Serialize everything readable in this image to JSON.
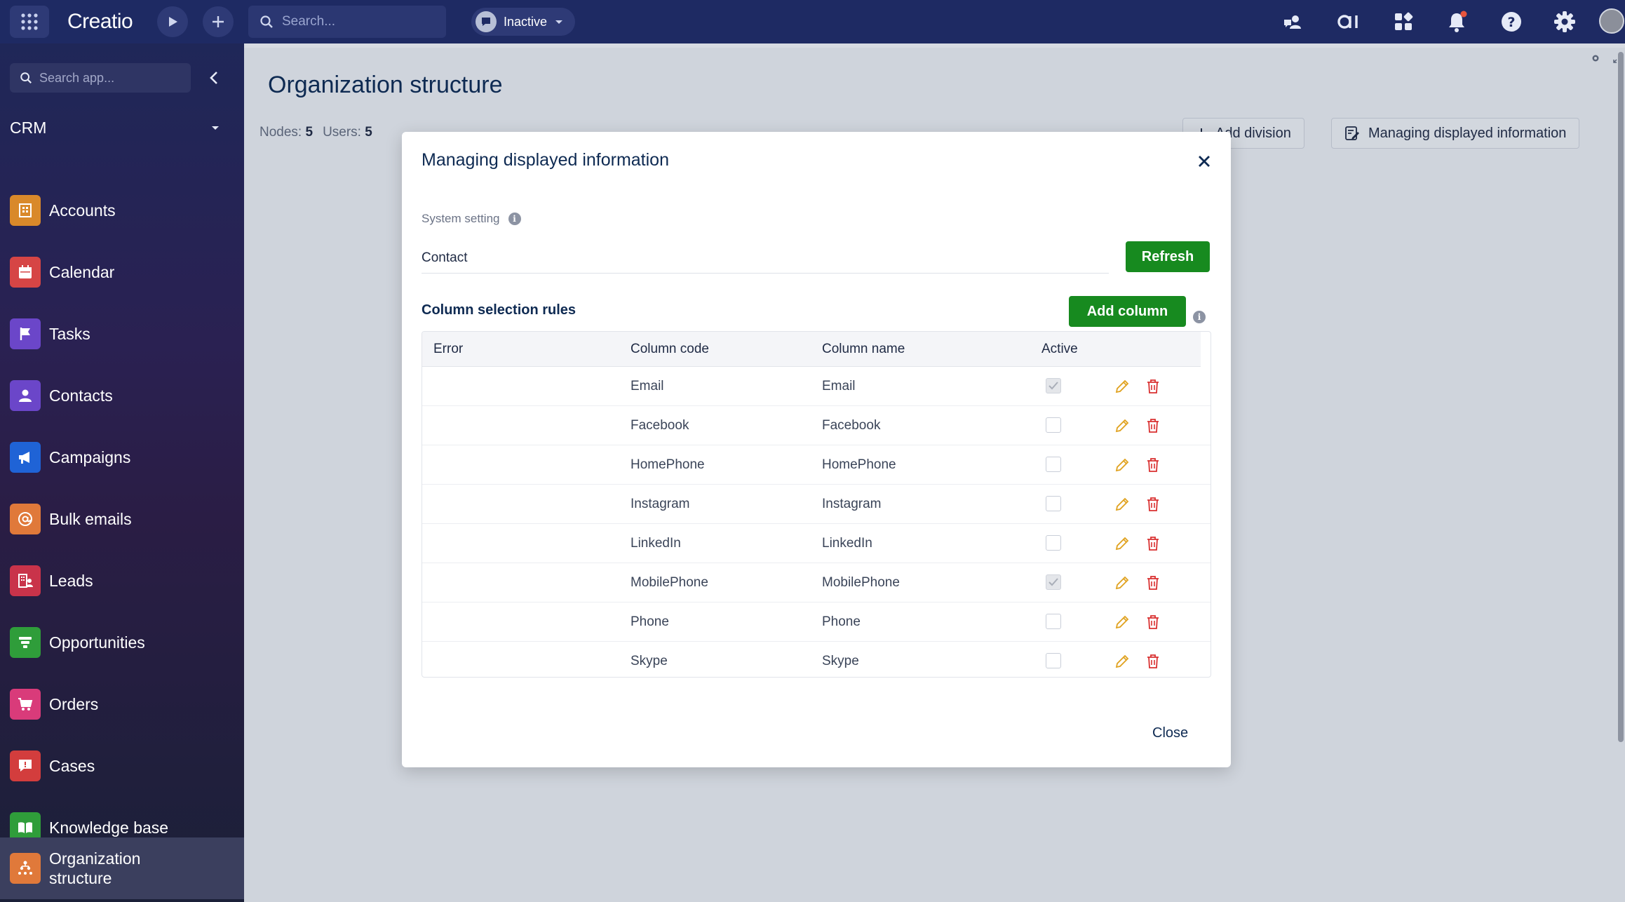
{
  "topbar": {
    "logo": "Creatio",
    "search_placeholder": "Search...",
    "status": "Inactive"
  },
  "sidebar": {
    "search_placeholder": "Search app...",
    "workspace": "CRM",
    "items": [
      {
        "label": "Accounts",
        "icon": "building-icon",
        "color": "#d9892a"
      },
      {
        "label": "Calendar",
        "icon": "calendar-icon",
        "color": "#d64545"
      },
      {
        "label": "Tasks",
        "icon": "flag-icon",
        "color": "#6b46c9"
      },
      {
        "label": "Contacts",
        "icon": "person-icon",
        "color": "#6b46c9"
      },
      {
        "label": "Campaigns",
        "icon": "megaphone-icon",
        "color": "#1f63d6"
      },
      {
        "label": "Bulk emails",
        "icon": "at-icon",
        "color": "#e0793a"
      },
      {
        "label": "Leads",
        "icon": "leads-icon",
        "color": "#c9334a"
      },
      {
        "label": "Opportunities",
        "icon": "funnel-icon",
        "color": "#2f9d3a"
      },
      {
        "label": "Orders",
        "icon": "cart-icon",
        "color": "#d93b7a"
      },
      {
        "label": "Cases",
        "icon": "chat-alert-icon",
        "color": "#d33d3d"
      },
      {
        "label": "Knowledge base",
        "icon": "book-icon",
        "color": "#2f9d3a"
      },
      {
        "label": "Organization structure",
        "icon": "org-chart-icon",
        "color": "#e0793a"
      }
    ]
  },
  "page": {
    "title": "Organization structure",
    "nodes_label": "Nodes:",
    "nodes_value": "5",
    "users_label": "Users:",
    "users_value": "5",
    "add_division": "Add division",
    "managing_info": "Managing displayed information"
  },
  "modal": {
    "title": "Managing displayed information",
    "system_setting_label": "System setting",
    "system_setting_value": "Contact",
    "refresh": "Refresh",
    "rules_heading": "Column selection rules",
    "add_column": "Add column",
    "columns": [
      "Error",
      "Column code",
      "Column name",
      "Active"
    ],
    "rows": [
      {
        "error": "",
        "code": "Email",
        "name": "Email",
        "active": true
      },
      {
        "error": "",
        "code": "Facebook",
        "name": "Facebook",
        "active": false
      },
      {
        "error": "",
        "code": "HomePhone",
        "name": "HomePhone",
        "active": false
      },
      {
        "error": "",
        "code": "Instagram",
        "name": "Instagram",
        "active": false
      },
      {
        "error": "",
        "code": "LinkedIn",
        "name": "LinkedIn",
        "active": false
      },
      {
        "error": "",
        "code": "MobilePhone",
        "name": "MobilePhone",
        "active": true
      },
      {
        "error": "",
        "code": "Phone",
        "name": "Phone",
        "active": false
      },
      {
        "error": "",
        "code": "Skype",
        "name": "Skype",
        "active": false
      }
    ],
    "close": "Close"
  },
  "colors": {
    "topbar": "#1e2a63",
    "primary_green": "#178a1f",
    "edit_icon": "#e0a21f",
    "delete_icon": "#d93030"
  }
}
